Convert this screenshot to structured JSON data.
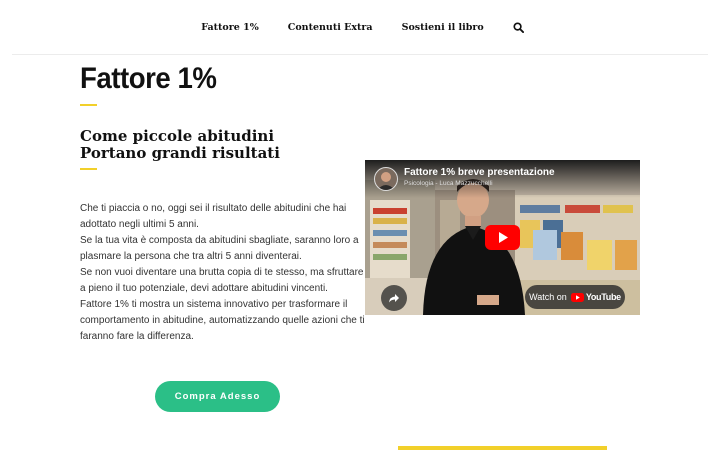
{
  "nav": {
    "items": [
      {
        "label": "Fattore 1%"
      },
      {
        "label": "Contenuti Extra"
      },
      {
        "label": "Sostieni il libro"
      }
    ],
    "search_icon": "search-icon"
  },
  "main": {
    "title": "Fattore 1%",
    "subtitle_line1": "Come piccole abitudini",
    "subtitle_line2": "Portano grandi risultati",
    "paragraphs": [
      "Che ti piaccia o no, oggi sei il risultato delle abitudini che hai adottato negli ultimi 5 anni.",
      "Se la tua vita è composta da abitudini sbagliate, saranno loro a plasmare la persona che tra altri 5 anni diventerai.",
      "Se non vuoi diventare una brutta copia di te stesso, ma sfruttare a pieno il tuo potenziale, devi adottare abitudini vincenti.",
      "Fattore 1% ti mostra un sistema innovativo per trasformare il comportamento in abitudine, automatizzando quelle azioni che ti faranno fare la differenza."
    ],
    "cta_label": "Compra Adesso"
  },
  "video": {
    "title": "Fattore 1% breve presentazione",
    "channel": "Psicologia - Luca Mazzucchelli",
    "watch_on": "Watch on",
    "youtube": "YouTube",
    "icons": [
      "play-icon",
      "share-icon",
      "youtube-logo-icon"
    ]
  },
  "colors": {
    "accent": "#f2d02a",
    "cta": "#2bbf87",
    "youtube_red": "#ff0000"
  }
}
